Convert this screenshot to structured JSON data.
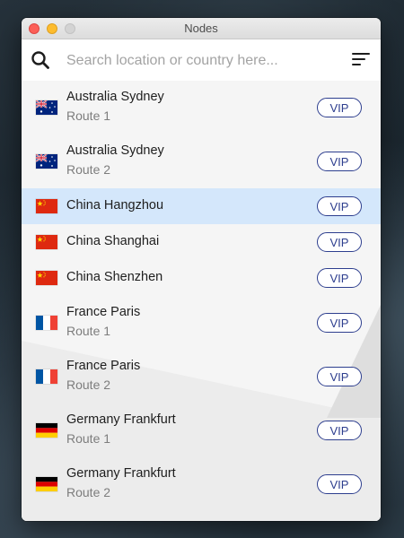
{
  "window": {
    "title": "Nodes"
  },
  "search": {
    "placeholder": "Search location or country here..."
  },
  "nodes": [
    {
      "name": "Australia Sydney",
      "route": "Route 1",
      "badge": "VIP",
      "flag": "australia-flag-icon"
    },
    {
      "name": "Australia Sydney",
      "route": "Route 2",
      "badge": "VIP",
      "flag": "australia-flag-icon"
    },
    {
      "name": "China Hangzhou",
      "route": "",
      "badge": "VIP",
      "flag": "china-flag-icon",
      "selected": true
    },
    {
      "name": "China Shanghai",
      "route": "",
      "badge": "VIP",
      "flag": "china-flag-icon"
    },
    {
      "name": "China Shenzhen",
      "route": "",
      "badge": "VIP",
      "flag": "china-flag-icon"
    },
    {
      "name": "France Paris",
      "route": "Route 1",
      "badge": "VIP",
      "flag": "france-flag-icon"
    },
    {
      "name": "France Paris",
      "route": "Route 2",
      "badge": "VIP",
      "flag": "france-flag-icon"
    },
    {
      "name": "Germany Frankfurt",
      "route": "Route 1",
      "badge": "VIP",
      "flag": "germany-flag-icon"
    },
    {
      "name": "Germany Frankfurt",
      "route": "Route 2",
      "badge": "VIP",
      "flag": "germany-flag-icon"
    }
  ],
  "colors": {
    "accent": "#2d3e8e",
    "selected_row": "#d4e7fb",
    "close": "#fc5f57",
    "minimize": "#fdbc2e"
  }
}
